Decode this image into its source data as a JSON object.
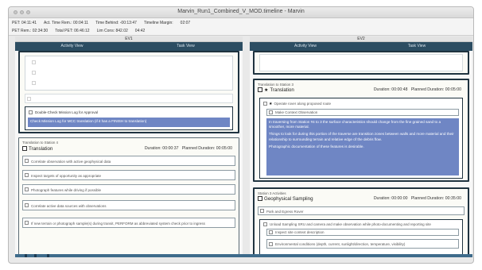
{
  "window": {
    "title": "Marvin_Run1_Combined_V_MOD.timeline - Marvin"
  },
  "info": {
    "row1": [
      "PET: 04:11:41",
      "Act. Time Rem.: 00:04:11",
      "Time Behind: -00:13:47",
      "Timeline Margin:",
      "02:07"
    ],
    "row2": [
      "PET Rem.: 02:34:30",
      "Total PET: 06:46:12",
      "Lim Cons: 842.02",
      "04:42"
    ]
  },
  "columns": [
    {
      "header": "EV1",
      "tabs": [
        "Activity View",
        "Task View"
      ],
      "top_card": {
        "faint_rows": [
          "",
          "",
          ""
        ],
        "check_row": "",
        "approve_item": "Double-Check Mission Log for Approval",
        "highlight": "Check Mission Log for MCC translation (if it has a FINISH to translation)"
      },
      "task": {
        "header": "Translation to Station 4",
        "title": "Translation",
        "duration_label": "Duration: 00:00:37",
        "planned_label": "Planned Duration: 00:05:00",
        "items": [
          "Correlate observation with active geophysical data",
          "Inspect targets of opportunity as appropriate",
          "Photograph features while driving if possible",
          "Correlate active data sources with observations",
          "If new terrain or photograph sample(s) during transit, PERFORM as abbreviated system check prior to ingress"
        ]
      }
    },
    {
      "header": "EV2",
      "tabs": [
        "Activity View",
        "Task View"
      ],
      "task1": {
        "header": "Translation to Station 3",
        "title": "Translation",
        "duration_label": "Duration: 00:00:48",
        "planned_label": "Planned Duration: 00:05:00",
        "item": "Operate rover along proposed route",
        "subitem": "Make Context Observation",
        "highlight_paras": [
          "In traversing from Station #4 to 3 the surface characteristics should change from the fine grained sand to a smoother, more material.",
          "Things to look for during this portion of the traverse are transition zones between walls and more material and their relationship to surrounding terrain and relative edge of the debris flow.",
          "Photographic documentation of these features is desirable."
        ]
      },
      "task2": {
        "header": "Station 3 Activities",
        "title": "Geophysical Sampling",
        "duration_label": "Duration: 00:00:00",
        "planned_label": "Planned Duration: 00:35:00",
        "items": [
          "Park and Egress Rover",
          "Unload Sampling SRU and camera and make observation while photo-documenting and reporting site",
          "Inspect site context description",
          "Environmental conditions (depth, current, sunlight/direction, temperature, visibility)"
        ]
      }
    }
  ],
  "colors": {
    "header_bar": "#2c4d62",
    "highlight": "#6f86c4",
    "bottom_bar": "#3e6b8b"
  }
}
